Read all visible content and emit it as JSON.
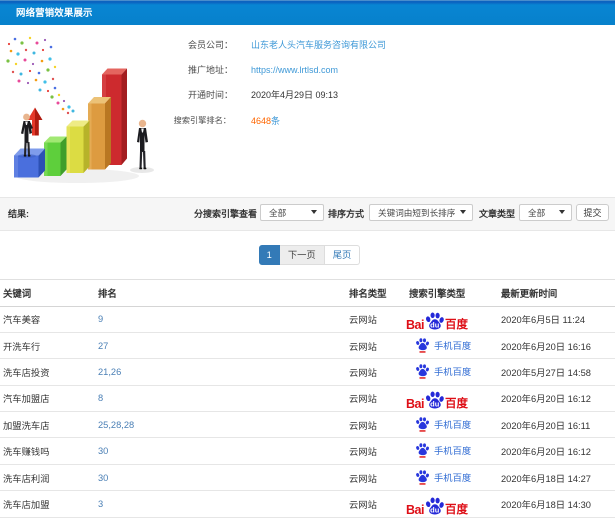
{
  "header": {
    "title": "网络营销效果展示"
  },
  "info": {
    "rows": [
      {
        "label": "会员公司：",
        "value": "山东老人头汽车服务咨询有限公司",
        "kind": "link"
      },
      {
        "label": "推广地址：",
        "value": "https://www.lrtlsd.com",
        "kind": "link"
      },
      {
        "label": "开通时间：",
        "value": "2020年4月29日 09:13",
        "kind": "text"
      },
      {
        "label": "搜索引擎排名：",
        "value": "4648",
        "suffix": "条",
        "kind": "highlight"
      }
    ]
  },
  "filters": {
    "section_label": "结果:",
    "engine_label": "分搜索引擎查看",
    "engine_value": "全部",
    "sort_label": "排序方式",
    "sort_value": "关键词由短到长排序",
    "article_label": "文章类型",
    "article_value": "全部",
    "submit_label": "提交"
  },
  "pagination": {
    "current": "1",
    "next_label": "下一页",
    "last_label": "尾页"
  },
  "table": {
    "headers": [
      "关键词",
      "排名",
      "排名类型",
      "搜索引擎类型",
      "最新更新时间"
    ],
    "rows": [
      {
        "keyword": "汽车美容",
        "rank": "9",
        "rank_type": "云网站",
        "engine": "baidu",
        "time": "2020年6月5日 11:24"
      },
      {
        "keyword": "开洗车行",
        "rank": "27",
        "rank_type": "云网站",
        "engine": "mobile-baidu",
        "time": "2020年6月20日 16:16"
      },
      {
        "keyword": "洗车店投资",
        "rank": "21,26",
        "rank_type": "云网站",
        "engine": "mobile-baidu",
        "time": "2020年5月27日 14:58"
      },
      {
        "keyword": "汽车加盟店",
        "rank": "8",
        "rank_type": "云网站",
        "engine": "baidu",
        "time": "2020年6月20日 16:12"
      },
      {
        "keyword": "加盟洗车店",
        "rank": "25,28,28",
        "rank_type": "云网站",
        "engine": "mobile-baidu",
        "time": "2020年6月20日 16:11"
      },
      {
        "keyword": "洗车赚钱吗",
        "rank": "30",
        "rank_type": "云网站",
        "engine": "mobile-baidu",
        "time": "2020年6月20日 16:12"
      },
      {
        "keyword": "洗车店利润",
        "rank": "30",
        "rank_type": "云网站",
        "engine": "mobile-baidu",
        "time": "2020年6月18日 14:27"
      },
      {
        "keyword": "洗车店加盟",
        "rank": "3",
        "rank_type": "云网站",
        "engine": "baidu",
        "time": "2020年6月18日 14:30"
      }
    ]
  },
  "logos": {
    "baidu": {
      "bai": "Bai",
      "du": "du",
      "cn": "百度"
    },
    "mobile_baidu": {
      "label": "手机百度"
    }
  },
  "colors": {
    "header_blue": "#0781cb",
    "link_blue": "#3f99d7",
    "highlight_orange": "#ff6600",
    "pagination_active": "#337ab7",
    "rank_link": "#4a7fb5",
    "baidu_red": "#de0f17",
    "baidu_blue": "#2529d8",
    "mobile_baidu_text": "#2f6bd3"
  }
}
